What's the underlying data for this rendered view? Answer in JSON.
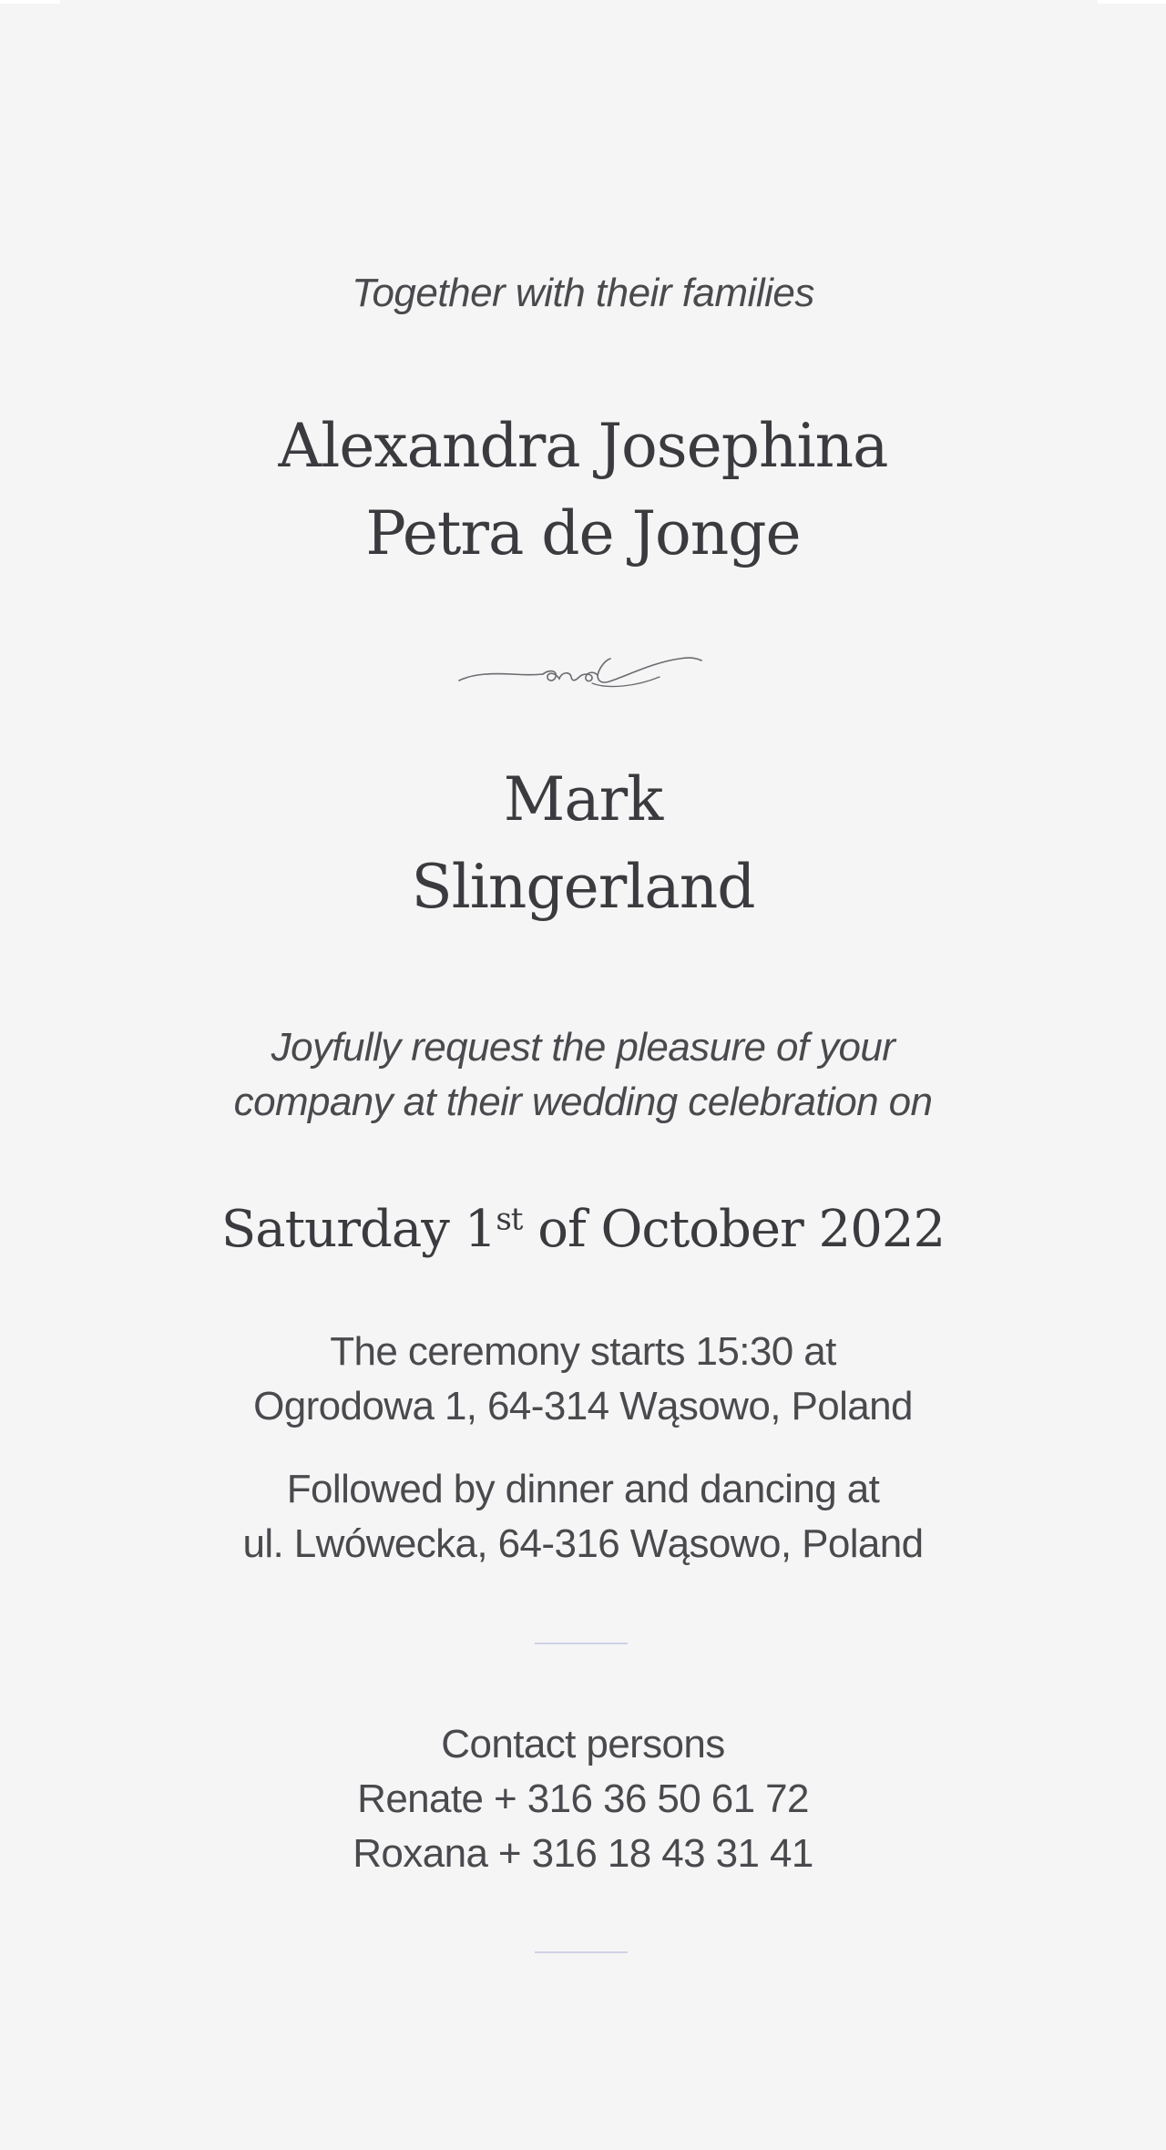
{
  "invitation": {
    "intro": "Together with their families",
    "bride": {
      "line1": "Alexandra Josephina",
      "line2": "Petra de Jonge"
    },
    "connector": "and",
    "groom": {
      "line1": "Mark",
      "line2": "Slingerland"
    },
    "request": {
      "line1": "Joyfully request the pleasure of your",
      "line2": "company at their wedding celebration on"
    },
    "date": {
      "weekday": "Saturday",
      "day": "1",
      "ordinal": "st",
      "rest": "of October 2022"
    },
    "ceremony": {
      "line1": "The ceremony starts 15:30 at",
      "line2": "Ogrodowa 1, 64-314 Wąsowo, Poland"
    },
    "dinner": {
      "line1": "Followed by dinner and dancing at",
      "line2": "ul. Lwówecka, 64-316 Wąsowo, Poland"
    },
    "contact": {
      "heading": "Contact persons",
      "person1": "Renate + 316 36 50 61 72",
      "person2": "Roxana + 316 18 43 31 41"
    }
  },
  "colors": {
    "background": "#f5f5f5",
    "text": "#3b3b3f",
    "divider": "#cfd1e6"
  }
}
